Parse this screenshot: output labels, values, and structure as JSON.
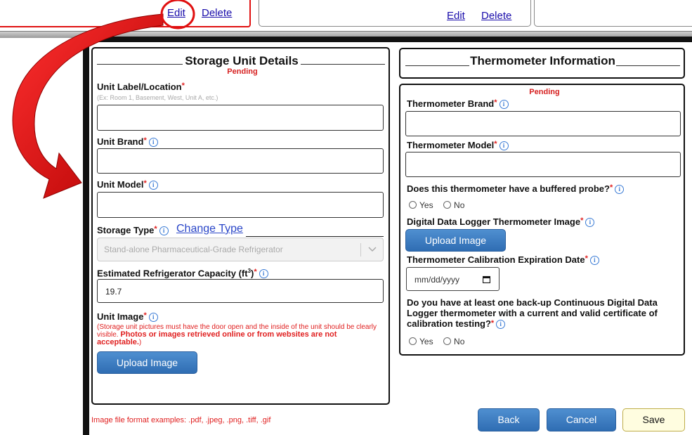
{
  "top": {
    "edit_label_1": "Edit",
    "delete_label_1": "Delete",
    "edit_label_2": "Edit",
    "delete_label_2": "Delete"
  },
  "storage": {
    "title": "Storage Unit Details",
    "status": "Pending",
    "unit_label": "Unit Label/Location",
    "unit_label_hint": "(Ex: Room 1, Basement, West, Unit A, etc.)",
    "unit_brand": "Unit Brand",
    "unit_model": "Unit Model",
    "storage_type": "Storage Type",
    "change_type": "Change Type",
    "storage_type_value": "Stand-alone Pharmaceutical-Grade Refrigerator",
    "capacity_label_a": "Estimated Refrigerator Capacity (ft",
    "capacity_sup": "3",
    "capacity_label_b": ")",
    "capacity_value": "19.7",
    "unit_image": "Unit Image",
    "image_note_a": "(Storage unit pictures must have the door open and the inside of the unit should be clearly visible. ",
    "image_note_b": "Photos or images retrieved online or from websites are not acceptable.",
    "image_note_c": ")",
    "upload": "Upload Image"
  },
  "thermo": {
    "title": "Thermometer Information",
    "status": "Pending",
    "brand": "Thermometer Brand",
    "model": "Thermometer Model",
    "buffered_q": "Does this thermometer have a buffered probe?",
    "yes": "Yes",
    "no": "No",
    "ddl_image": "Digital Data Logger Thermometer Image",
    "upload": "Upload Image",
    "calib_date": "Thermometer Calibration Expiration Date",
    "date_placeholder": "mm/dd/yyyy",
    "backup_q": "Do you have at least one back-up Continuous Digital Data Logger thermometer with a current and valid certificate of calibration testing?",
    "yes2": "Yes",
    "no2": "No"
  },
  "footer": {
    "formats": "Image file format examples: .pdf, .jpeg, .png, .tiff, .gif",
    "back": "Back",
    "cancel": "Cancel",
    "save": "Save"
  },
  "colors": {
    "arrow": "#e01010",
    "accent": "#2f6db3"
  },
  "star": "*",
  "info_glyph": "i"
}
